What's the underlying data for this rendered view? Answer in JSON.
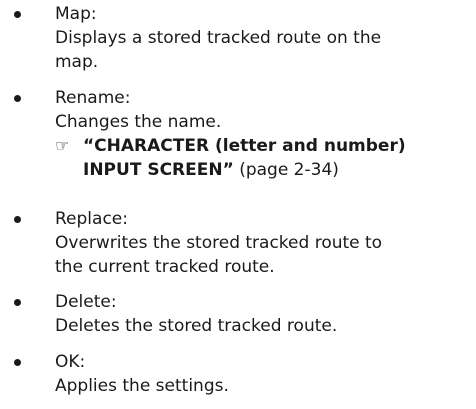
{
  "items": [
    {
      "label": "Map:",
      "lines": [
        "Displays a stored tracked route on the",
        "map."
      ]
    },
    {
      "label": "Rename:",
      "lines": [
        "Changes the name."
      ],
      "reference": {
        "icon": "reference-hand-icon",
        "title_line1": "“CHARACTER (letter and number)",
        "title_line2": "INPUT SCREEN”",
        "page": "(page 2-34)"
      }
    },
    {
      "label": "Replace:",
      "lines": [
        "Overwrites the stored tracked route to",
        "the current tracked route."
      ]
    },
    {
      "label": "Delete:",
      "lines": [
        "Deletes the stored tracked route."
      ]
    },
    {
      "label": "OK:",
      "lines": [
        "Applies the settings."
      ]
    }
  ]
}
